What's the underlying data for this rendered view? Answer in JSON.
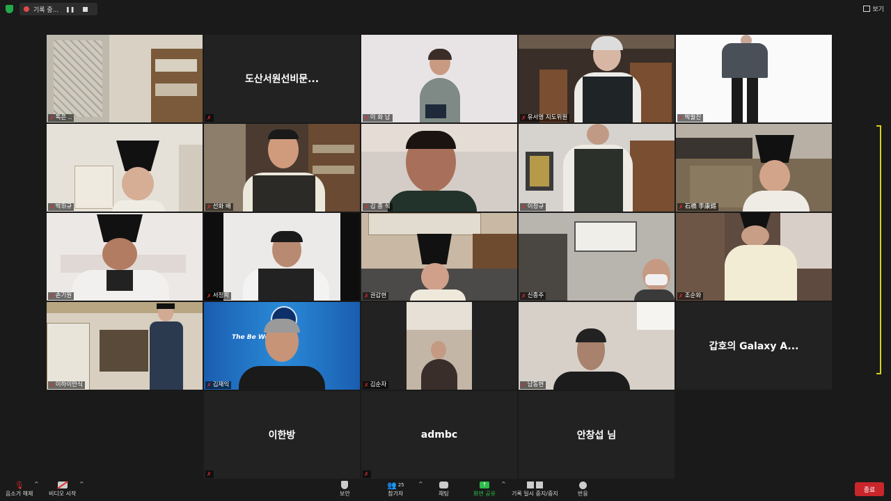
{
  "topbar": {
    "recording_label": "기록 중...",
    "view_label": "보기"
  },
  "tiles": [
    {
      "name": "톡은 .. "
    },
    {
      "name": "",
      "center_name": "도산서원선비문..."
    },
    {
      "name": "이 화 남"
    },
    {
      "name": "유서영 지도위원"
    },
    {
      "name": "박월진"
    },
    {
      "name": "박휘규"
    },
    {
      "name": "선화 배"
    },
    {
      "name": "김 종 식"
    },
    {
      "name": "이정규"
    },
    {
      "name": "石橋 李康錫"
    },
    {
      "name": "손기원"
    },
    {
      "name": "서정희"
    },
    {
      "name": "권갑현"
    },
    {
      "name": "신종주"
    },
    {
      "name": "조순화"
    },
    {
      "name": "이하이만식"
    },
    {
      "name": "김재익"
    },
    {
      "name": "김순자"
    },
    {
      "name": "남동현"
    },
    {
      "name": "",
      "center_name": "갑호의 Galaxy A..."
    },
    {
      "name": "",
      "center_name": "이한방"
    },
    {
      "name": "",
      "center_name": "admbc"
    },
    {
      "name": "",
      "center_name": "안창섭 님"
    }
  ],
  "toolbar": {
    "unmute": "음소거 해제",
    "start_video": "비디오 시작",
    "security": "보안",
    "participants": "참가자",
    "participants_count": "25",
    "chat": "채팅",
    "share_screen": "화면 공유",
    "pause_record": "기록 일시 중지/중지",
    "reactions": "반응",
    "end": "종료"
  },
  "colors": {
    "share_green": "#2dbb4a",
    "end_red": "#c9262c",
    "mic_off_red": "#e02d2d",
    "active_speaker_yellow": "#d6d11e"
  }
}
